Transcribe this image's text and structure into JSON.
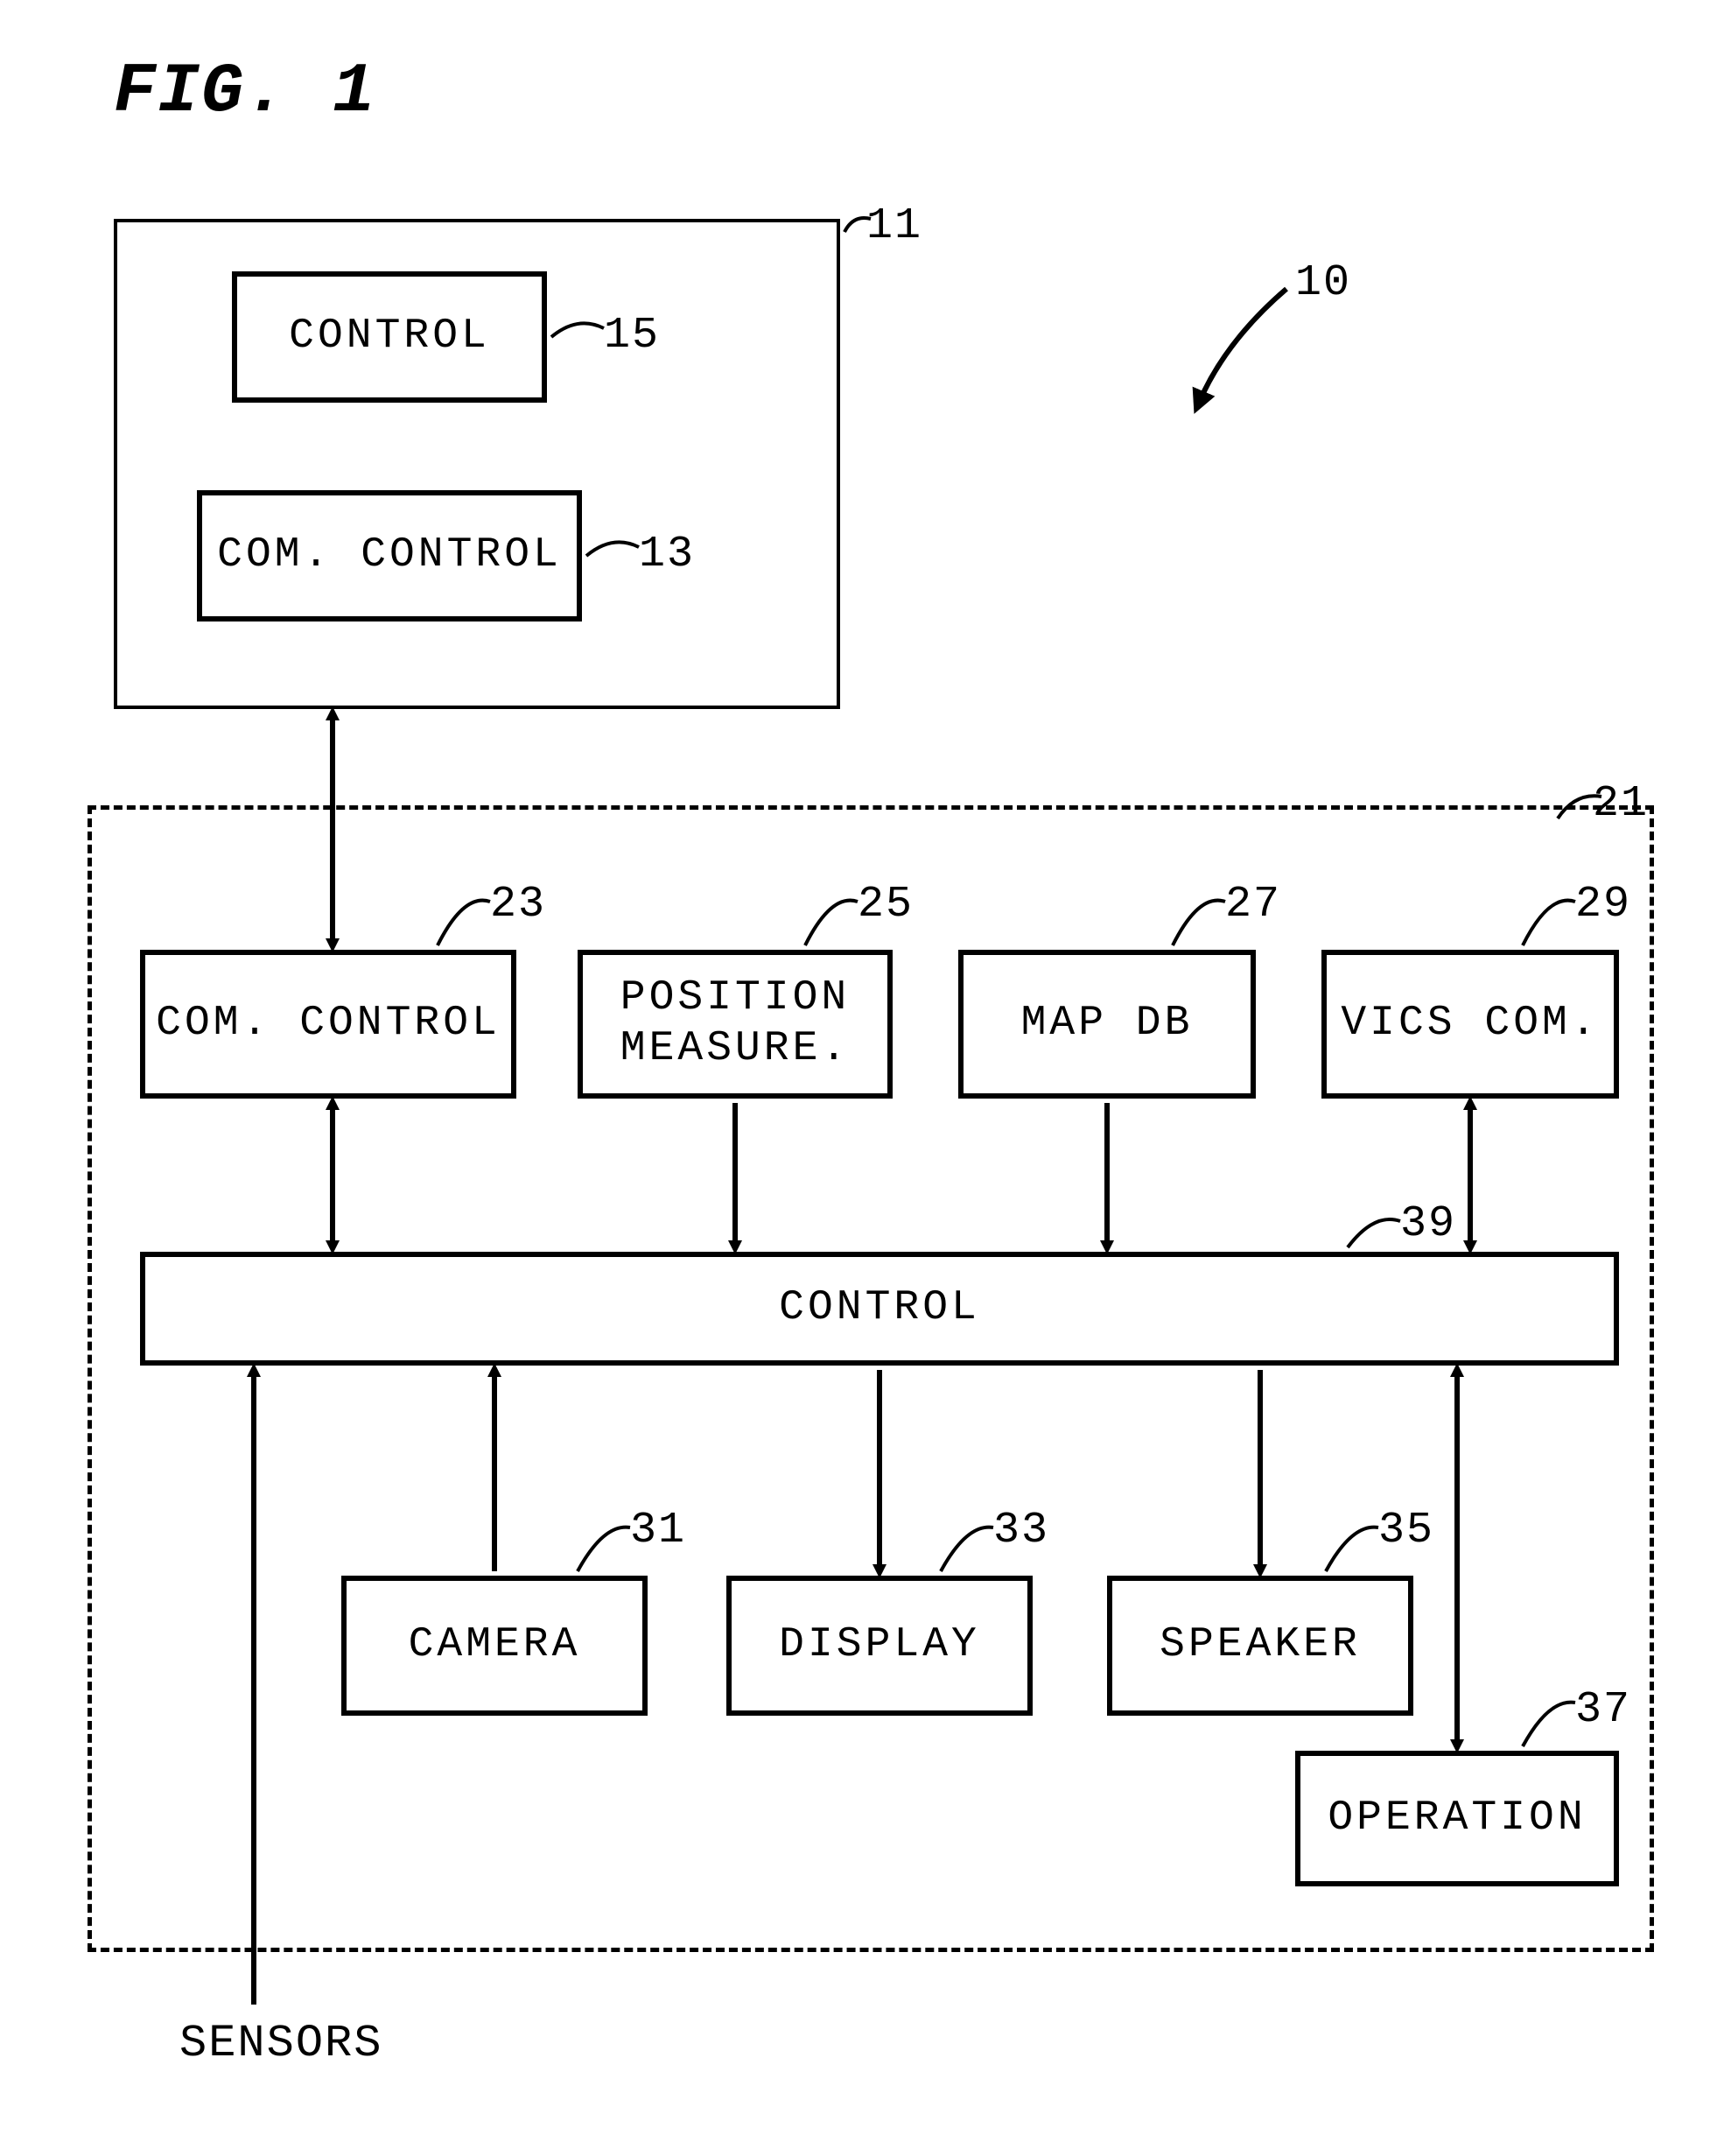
{
  "figure_title": "FIG. 1",
  "labels": {
    "system": "10",
    "center": "11",
    "center_control": "15",
    "center_com_control": "13",
    "terminal": "21",
    "term_com_control": "23",
    "position_measure": "25",
    "map_db": "27",
    "vics_com": "29",
    "term_control": "39",
    "camera": "31",
    "display": "33",
    "speaker": "35",
    "operation": "37"
  },
  "boxes": {
    "control15": "CONTROL",
    "com_control13": "COM. CONTROL",
    "com_control23": "COM. CONTROL",
    "position25": "POSITION\nMEASURE.",
    "mapdb27": "MAP DB",
    "vics29": "VICS COM.",
    "control39": "CONTROL",
    "camera31": "CAMERA",
    "display33": "DISPLAY",
    "speaker35": "SPEAKER",
    "operation37": "OPERATION"
  },
  "sensors_label": "SENSORS"
}
